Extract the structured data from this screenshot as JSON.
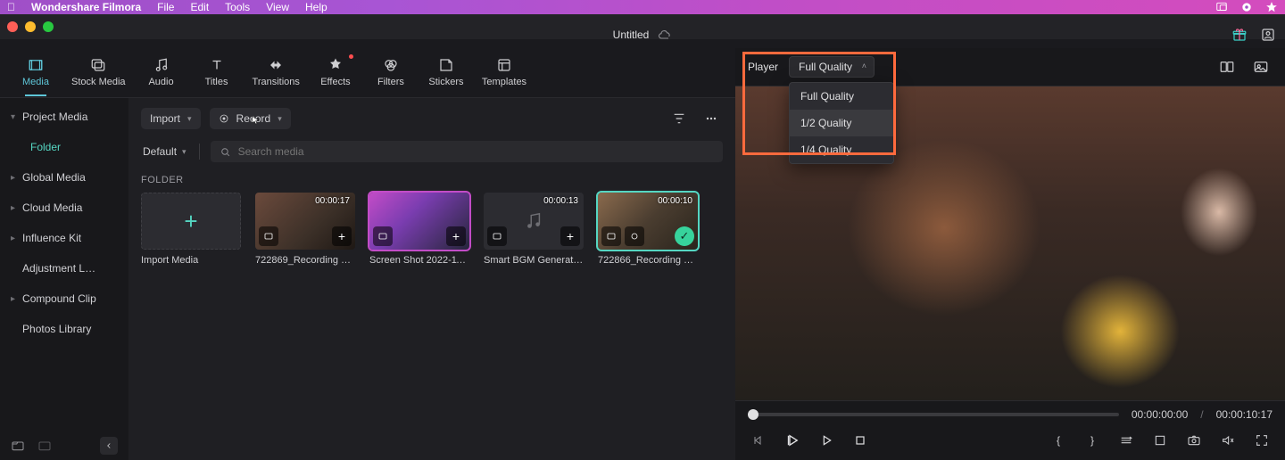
{
  "menubar": {
    "app_name": "Wondershare Filmora",
    "items": [
      "File",
      "Edit",
      "Tools",
      "View",
      "Help"
    ]
  },
  "titlebar": {
    "doc_title": "Untitled"
  },
  "top_tabs": [
    {
      "id": "media",
      "label": "Media"
    },
    {
      "id": "stock",
      "label": "Stock Media"
    },
    {
      "id": "audio",
      "label": "Audio"
    },
    {
      "id": "titles",
      "label": "Titles"
    },
    {
      "id": "transitions",
      "label": "Transitions"
    },
    {
      "id": "effects",
      "label": "Effects"
    },
    {
      "id": "filters",
      "label": "Filters"
    },
    {
      "id": "stickers",
      "label": "Stickers"
    },
    {
      "id": "templates",
      "label": "Templates"
    }
  ],
  "sidebar": {
    "items": [
      {
        "label": "Project Media"
      },
      {
        "label": "Global Media"
      },
      {
        "label": "Cloud Media"
      },
      {
        "label": "Influence Kit"
      },
      {
        "label": "Adjustment L…"
      },
      {
        "label": "Compound Clip"
      },
      {
        "label": "Photos Library"
      }
    ],
    "child_label": "Folder"
  },
  "browser": {
    "import_label": "Import",
    "record_label": "Record",
    "sort_label": "Default",
    "search_placeholder": "Search media",
    "section_label": "FOLDER",
    "import_media_label": "Import Media",
    "clips": [
      {
        "name": "722869_Recording P…",
        "duration": "00:00:17",
        "kind": "video"
      },
      {
        "name": "Screen Shot 2022-11…",
        "duration": "",
        "kind": "screenshot"
      },
      {
        "name": "Smart BGM Generati…",
        "duration": "00:00:13",
        "kind": "audio"
      },
      {
        "name": "722866_Recording P…",
        "duration": "00:00:10",
        "kind": "video-selected"
      }
    ]
  },
  "player": {
    "label": "Player",
    "quality_selected": "Full Quality",
    "quality_options": [
      "Full Quality",
      "1/2 Quality",
      "1/4 Quality"
    ],
    "time_current": "00:00:00:00",
    "time_total": "00:00:10:17"
  }
}
